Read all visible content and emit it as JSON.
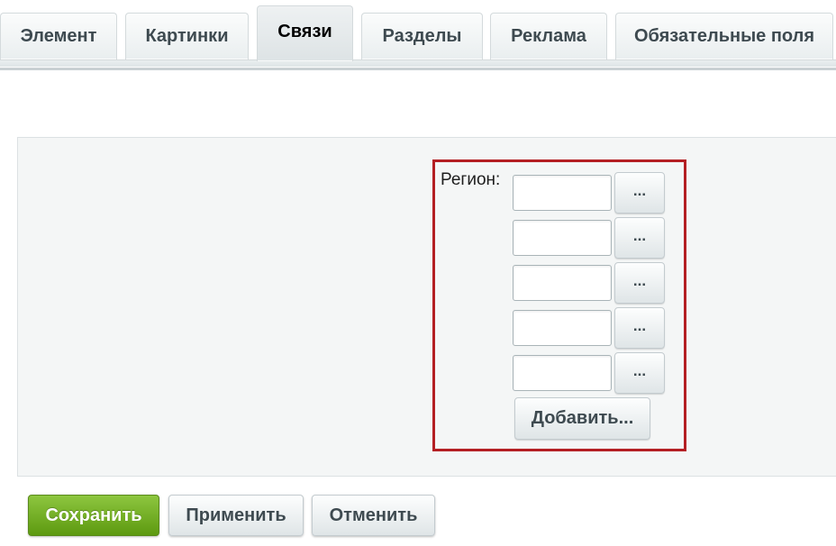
{
  "tabs": [
    {
      "label": "Элемент",
      "active": false
    },
    {
      "label": "Картинки",
      "active": false
    },
    {
      "label": "Связи",
      "active": true
    },
    {
      "label": "Разделы",
      "active": false
    },
    {
      "label": "Реклама",
      "active": false
    },
    {
      "label": "Обязательные поля",
      "active": false
    }
  ],
  "region": {
    "label": "Регион:",
    "inputs": [
      {
        "value": "",
        "browse_label": "..."
      },
      {
        "value": "",
        "browse_label": "..."
      },
      {
        "value": "",
        "browse_label": "..."
      },
      {
        "value": "",
        "browse_label": "..."
      },
      {
        "value": "",
        "browse_label": "..."
      }
    ],
    "add_label": "Добавить..."
  },
  "footer": {
    "save_label": "Сохранить",
    "apply_label": "Применить",
    "cancel_label": "Отменить"
  },
  "colors": {
    "highlight_border": "#b41f23",
    "save_button": "#6fad1f",
    "panel_background": "#f4f6f6",
    "tab_text": "#3e4a50"
  }
}
